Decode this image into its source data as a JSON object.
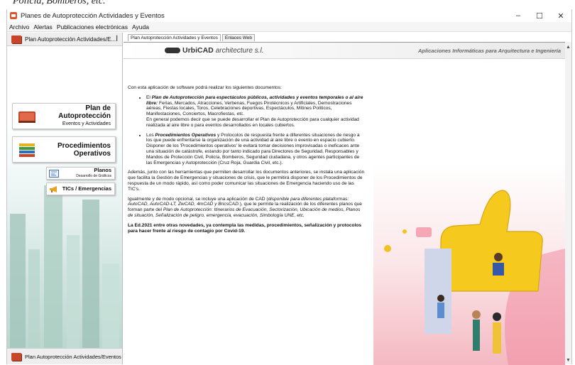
{
  "bg_text": "Policía, Bomberos, etc.",
  "window": {
    "title": "Planes de Autoprotección Actividades y Eventos",
    "controls": {
      "minimize": "–",
      "maximize": "☐",
      "close": "✕"
    }
  },
  "menu": [
    "Archivo",
    "Alertas",
    "Publicaciones electrónicas",
    "Ayuda"
  ],
  "left_panel": {
    "header": "Plan Autoprotección Actividades/E...",
    "pin": "ꟾ",
    "buttons": {
      "plan": {
        "line1": "Plan de Autoprotección",
        "line2": "Eventos y Actividades"
      },
      "procedimientos": {
        "line1": "Procedimientos",
        "line2": "Operativos"
      },
      "planos": {
        "line1": "Planos",
        "line2": "Desarrollo de Gráficos"
      },
      "tics": {
        "line1": "TICs / Emergencias"
      }
    },
    "footer": "Plan Autoprotección Actividades/Eventos"
  },
  "tabs": [
    "Plan Autoprotección Actividades y Eventos",
    "Enlaces Web"
  ],
  "header": {
    "logo_bold": "UrbiCAD",
    "logo_italic": "architecture s.l.",
    "tagline": "Aplicaciones Informáticas para Arquitectura e Ingeniería"
  },
  "content": {
    "intro": "Con esta aplicación de software podrá realizar los siguientes documentos:",
    "bullet1_lead": "El ",
    "bullet1_bold": "Plan de Autoprotección para espectáculos públicos, actividades y eventos temporales o al aire libre:",
    "bullet1_text": " Ferias, Mercados, Atracciones, Verbenas, Fuegos Pirotécnicos y Artificiales, Demostraciones aéreas, Fiestas locales, Toros, Celebraciones deportivas, Espectáculos, Mítines Políticos, Manifestaciones, Conciertos, Macrofiestas, etc.",
    "bullet1_more": "En general podemos decir que se puede desarrollar el Plan de Autoprotección para cualquier actividad realizada al aire libre o para eventos desarrollados en locales cubiertos.",
    "bullet2_lead": "Los ",
    "bullet2_bold": "Procedimientos Operativos",
    "bullet2_text": " y Protocolos de respuesta frente a diferentes situaciones de riesgo a los que puede enfrentarse la organización de una actividad al aire libre o evento en espacio cubierto.",
    "bullet2_more": "Disponer de los 'Procedimientos operativos' le evitará tomar decisiones improvisadas o ineficaces ante una situación de catástrofe, estando por tanto indicado para Directores de Seguridad, Responsables y Mandos de Protección Civil, Policía, Bomberos, Seguridad ciudadana, y otros agentes participantes de las Emergencias y Autoprotección (Cruz Roja, Guardia Civil, etc.).",
    "para1": "Además, junto con las herramientas que permiten desarrollar los documentos anteriores, se instala una aplicación que facilita la Gestión de Emergencias y situaciones de crisis, que le permitirá disponer de los Procedimientos de respuesta de un modo rápido, así como poder comunicar las situaciones de Emergencia haciendo uso de las TIC's.",
    "para2_a": "Igualmente y de modo opcional, se incluye una aplicación de CAD (",
    "para2_b": "disponible para diferentes plataformas: AutoCAD, AutoCAD-LT, ZwCAD, 4mCAD y BricsCAD.",
    "para2_c": "), que le permite la realización de los diferentes planos que forman parte del ",
    "para2_d": "Plan de Autoprotección: Itinerarios de Evacuación, Sectorización, Ubicación de medios, Planos de situación, Señalización de peligro, emergencia, evacuación, Simbología UNE, etc.",
    "para3": "La Ed.2021 entre otras novedades, ya contempla las medidas, procedimientos, señalización y protocolos para hacer frente al riesgo de contagio por Covid-19."
  },
  "scrollbar": {
    "up": "▲",
    "down": "▼"
  },
  "colors": {
    "accent_red": "#c9452a",
    "thumb_yellow": "#f6c91e",
    "sky_pink": "#f7c9cf"
  }
}
